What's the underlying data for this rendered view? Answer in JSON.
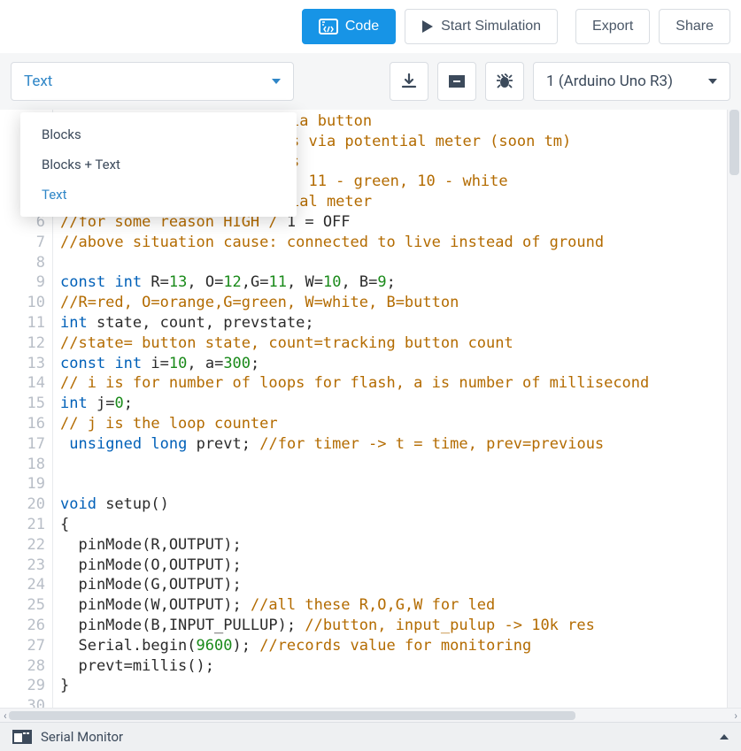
{
  "topbar": {
    "code": "Code",
    "start": "Start Simulation",
    "export": "Export",
    "share": "Share"
  },
  "mode": {
    "selected": "Text",
    "options": [
      "Blocks",
      "Blocks + Text",
      "Text"
    ]
  },
  "device": {
    "selected": "1 (Arduino Uno R3)"
  },
  "editor": {
    "first_line": 1,
    "lines": [
      {
        "t": "comment",
        "text": "ia button"
      },
      {
        "t": "comment",
        "text": "s via potential meter (soon tm)"
      },
      {
        "t": "comment",
        "text": "s"
      },
      {
        "t": "comment",
        "text": ", 11 - green, 10 - white"
      },
      {
        "t": "comment",
        "text": "ial meter"
      },
      {
        "t": "mixed",
        "parts": [
          {
            "s": "comment",
            "v": "//for some reason HIGH / "
          },
          {
            "s": "plain",
            "v": "1 = OFF"
          }
        ]
      },
      {
        "t": "comment",
        "text": "//above situation cause: connected to live instead of ground"
      },
      {
        "t": "plain",
        "text": ""
      },
      {
        "t": "mixed",
        "parts": [
          {
            "s": "keyword",
            "v": "const"
          },
          {
            "s": "plain",
            "v": " "
          },
          {
            "s": "keyword",
            "v": "int"
          },
          {
            "s": "plain",
            "v": " R="
          },
          {
            "s": "num",
            "v": "13"
          },
          {
            "s": "plain",
            "v": ", O="
          },
          {
            "s": "num",
            "v": "12"
          },
          {
            "s": "plain",
            "v": ",G="
          },
          {
            "s": "num",
            "v": "11"
          },
          {
            "s": "plain",
            "v": ", W="
          },
          {
            "s": "num",
            "v": "10"
          },
          {
            "s": "plain",
            "v": ", B="
          },
          {
            "s": "num",
            "v": "9"
          },
          {
            "s": "plain",
            "v": ";"
          }
        ]
      },
      {
        "t": "comment",
        "text": "//R=red, O=orange,G=green, W=white, B=button"
      },
      {
        "t": "mixed",
        "parts": [
          {
            "s": "keyword",
            "v": "int"
          },
          {
            "s": "plain",
            "v": " state, count, prevstate;"
          }
        ]
      },
      {
        "t": "comment",
        "text": "//state= button state, count=tracking button count"
      },
      {
        "t": "mixed",
        "parts": [
          {
            "s": "keyword",
            "v": "const"
          },
          {
            "s": "plain",
            "v": " "
          },
          {
            "s": "keyword",
            "v": "int"
          },
          {
            "s": "plain",
            "v": " i="
          },
          {
            "s": "num",
            "v": "10"
          },
          {
            "s": "plain",
            "v": ", a="
          },
          {
            "s": "num",
            "v": "300"
          },
          {
            "s": "plain",
            "v": ";"
          }
        ]
      },
      {
        "t": "comment",
        "text": "// i is for number of loops for flash, a is number of millisecond"
      },
      {
        "t": "mixed",
        "parts": [
          {
            "s": "keyword",
            "v": "int"
          },
          {
            "s": "plain",
            "v": " j="
          },
          {
            "s": "num",
            "v": "0"
          },
          {
            "s": "plain",
            "v": ";"
          }
        ]
      },
      {
        "t": "comment",
        "text": "// j is the loop counter"
      },
      {
        "t": "mixed",
        "parts": [
          {
            "s": "plain",
            "v": " "
          },
          {
            "s": "keyword",
            "v": "unsigned"
          },
          {
            "s": "plain",
            "v": " "
          },
          {
            "s": "keyword",
            "v": "long"
          },
          {
            "s": "plain",
            "v": " prevt; "
          },
          {
            "s": "comment",
            "v": "//for timer -> t = time, prev=previous"
          }
        ]
      },
      {
        "t": "plain",
        "text": ""
      },
      {
        "t": "plain",
        "text": ""
      },
      {
        "t": "mixed",
        "parts": [
          {
            "s": "keyword",
            "v": "void"
          },
          {
            "s": "plain",
            "v": " setup()"
          }
        ]
      },
      {
        "t": "plain",
        "text": "{"
      },
      {
        "t": "plain",
        "text": "  pinMode(R,OUTPUT);"
      },
      {
        "t": "plain",
        "text": "  pinMode(O,OUTPUT);"
      },
      {
        "t": "plain",
        "text": "  pinMode(G,OUTPUT);"
      },
      {
        "t": "mixed",
        "parts": [
          {
            "s": "plain",
            "v": "  pinMode(W,OUTPUT); "
          },
          {
            "s": "comment",
            "v": "//all these R,O,G,W for led"
          }
        ]
      },
      {
        "t": "mixed",
        "parts": [
          {
            "s": "plain",
            "v": "  pinMode(B,INPUT_PULLUP); "
          },
          {
            "s": "comment",
            "v": "//button, input_pulup -> 10k res"
          }
        ]
      },
      {
        "t": "mixed",
        "parts": [
          {
            "s": "plain",
            "v": "  Serial.begin("
          },
          {
            "s": "num",
            "v": "9600"
          },
          {
            "s": "plain",
            "v": "); "
          },
          {
            "s": "comment",
            "v": "//records value for monitoring"
          }
        ]
      },
      {
        "t": "plain",
        "text": "  prevt=millis();"
      },
      {
        "t": "plain",
        "text": "}"
      },
      {
        "t": "plain",
        "text": ""
      },
      {
        "t": "plain",
        "text": ""
      }
    ]
  },
  "bottom": {
    "serial_monitor": "Serial Monitor"
  }
}
